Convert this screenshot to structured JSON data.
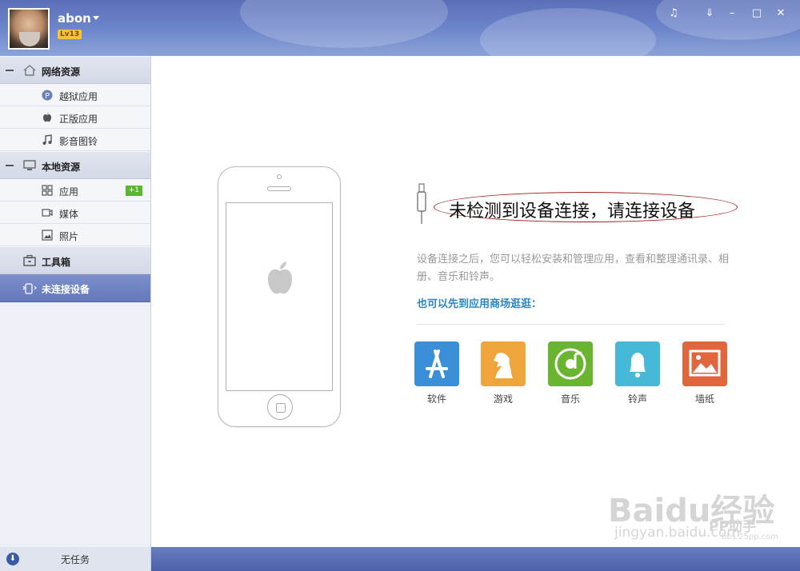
{
  "header": {
    "username": "abon",
    "level": "Lv13",
    "controls": [
      "♫",
      "⇓",
      "–",
      "□",
      "✕"
    ]
  },
  "sidebar": {
    "groups": [
      {
        "label": "网络资源",
        "items": [
          {
            "label": "越狱应用"
          },
          {
            "label": "正版应用"
          },
          {
            "label": "影音图铃"
          }
        ]
      },
      {
        "label": "本地资源",
        "items": [
          {
            "label": "应用",
            "badge": "+1"
          },
          {
            "label": "媒体"
          },
          {
            "label": "照片"
          }
        ]
      },
      {
        "label": "工具箱"
      }
    ],
    "active": {
      "label": "未连接设备"
    }
  },
  "main": {
    "headline": "未检测到设备连接，请连接设备",
    "description": "设备连接之后，您可以轻松安装和管理应用，查看和整理通讯录、相册、音乐和铃声。",
    "store_link": "也可以先到应用商场逛逛：",
    "tiles": [
      {
        "label": "软件",
        "color": "#3a8fd8"
      },
      {
        "label": "游戏",
        "color": "#f0a43c"
      },
      {
        "label": "音乐",
        "color": "#69b52f"
      },
      {
        "label": "铃声",
        "color": "#46b8d8"
      },
      {
        "label": "墙纸",
        "color": "#e0663e"
      }
    ]
  },
  "footer": {
    "task_status": "无任务"
  },
  "watermark": {
    "brand": "Baidu经验",
    "url": "jingyan.baidu.com",
    "pp": "PP助手",
    "site": "bbs.25pp.com"
  }
}
